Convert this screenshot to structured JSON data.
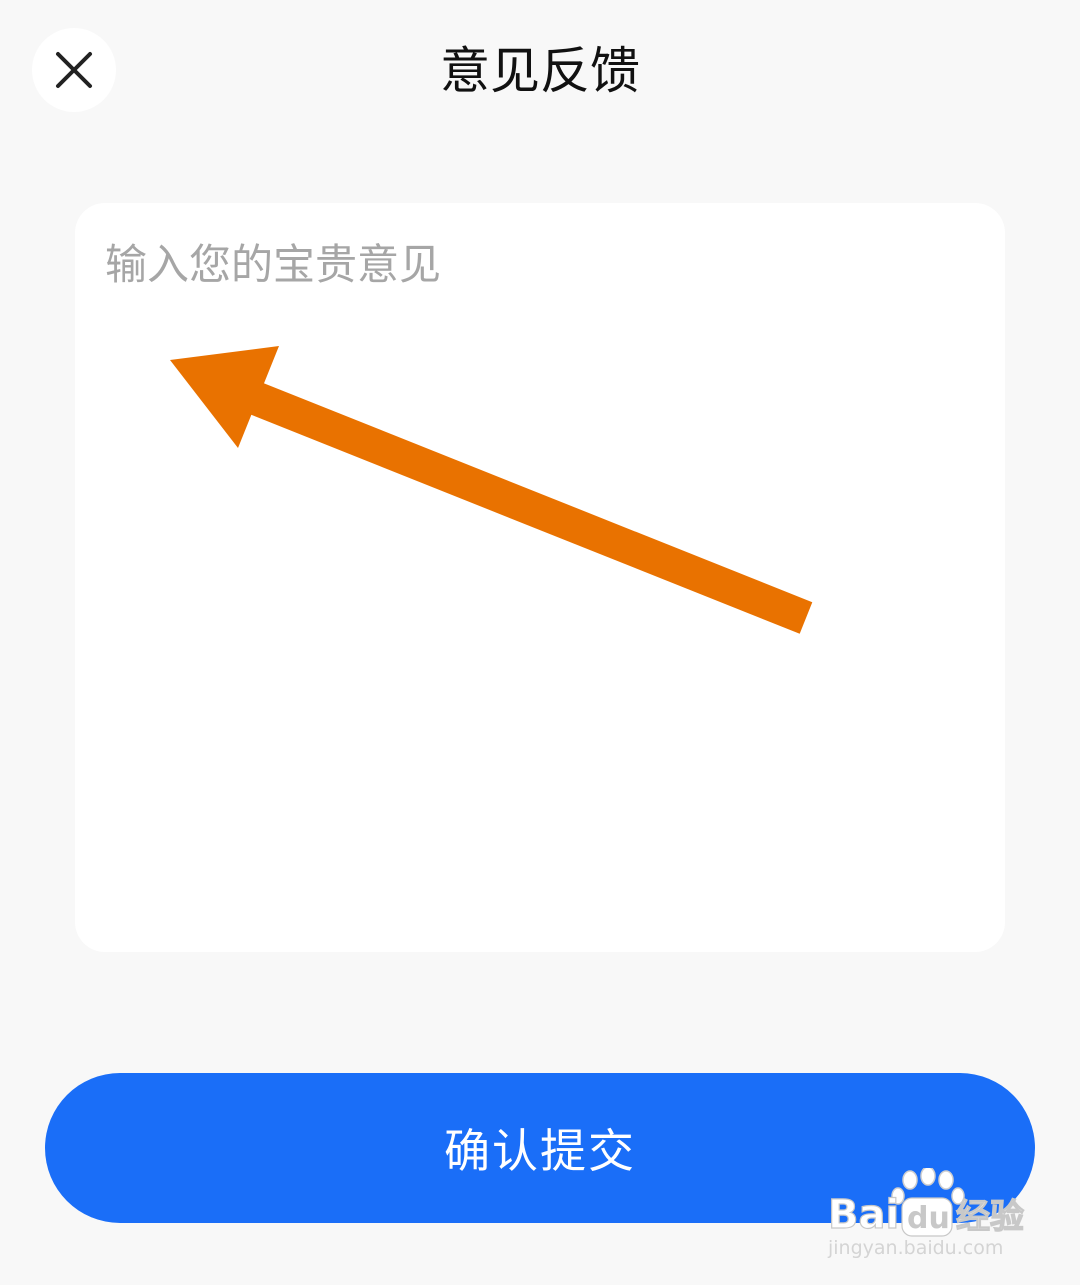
{
  "header": {
    "title": "意见反馈",
    "close_icon": "close-icon"
  },
  "feedback": {
    "placeholder": "输入您的宝贵意见",
    "value": ""
  },
  "submit": {
    "label": "确认提交"
  },
  "colors": {
    "background": "#f8f8f8",
    "card": "#ffffff",
    "accent": "#1a6ef8",
    "annotation_arrow": "#e97200",
    "placeholder": "#a6a6a6"
  },
  "watermark": {
    "brand_logo": "Bai du 经验",
    "url": "jingyan.baidu.com"
  }
}
